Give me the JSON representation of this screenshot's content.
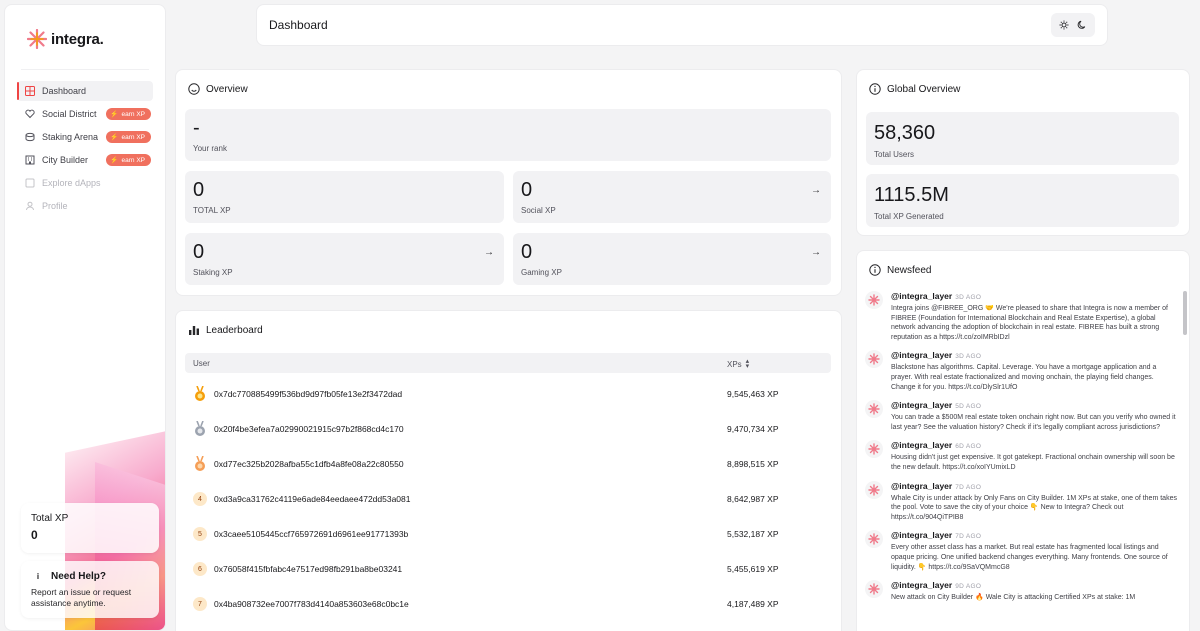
{
  "app": {
    "name": "integra."
  },
  "sidebar": {
    "items": [
      {
        "label": "Dashboard",
        "icon": "grid-icon",
        "active": true
      },
      {
        "label": "Social District",
        "icon": "heart-icon",
        "badge": "earn XP"
      },
      {
        "label": "Staking Arena",
        "icon": "database-icon",
        "badge": "earn XP"
      },
      {
        "label": "City Builder",
        "icon": "building-icon",
        "badge": "earn XP"
      },
      {
        "label": "Explore dApps",
        "icon": "apps-icon",
        "disabled": true
      },
      {
        "label": "Profile",
        "icon": "user-icon",
        "disabled": true
      }
    ],
    "total_xp": {
      "label": "Total XP",
      "value": "0"
    },
    "help": {
      "title": "Need Help?",
      "text": "Report an issue or request assistance anytime."
    }
  },
  "header": {
    "title": "Dashboard"
  },
  "overview": {
    "title": "Overview",
    "rank": {
      "value": "-",
      "label": "Your rank"
    },
    "stats": [
      {
        "value": "0",
        "label": "TOTAL XP"
      },
      {
        "value": "0",
        "label": "Social XP"
      },
      {
        "value": "0",
        "label": "Staking XP"
      },
      {
        "value": "0",
        "label": "Gaming XP"
      }
    ]
  },
  "leaderboard": {
    "title": "Leaderboard",
    "columns": [
      "User",
      "XPs"
    ],
    "rows": [
      {
        "rank": "1",
        "address": "0x7dc770885499f536bd9d97fb05fe13e2f3472dad",
        "xp": "9,545,463 XP"
      },
      {
        "rank": "2",
        "address": "0x20f4be3efea7a02990021915c97b2f868cd4c170",
        "xp": "9,470,734 XP"
      },
      {
        "rank": "3",
        "address": "0xd77ec325b2028afba55c1dfb4a8fe08a22c80550",
        "xp": "8,898,515 XP"
      },
      {
        "rank": "4",
        "address": "0xd3a9ca31762c4119e6ade84eedaee472dd53a081",
        "xp": "8,642,987 XP"
      },
      {
        "rank": "5",
        "address": "0x3caee5105445ccf765972691d6961ee91771393b",
        "xp": "5,532,187 XP"
      },
      {
        "rank": "6",
        "address": "0x76058f415fbfabc4e7517ed98fb291ba8be03241",
        "xp": "5,455,619 XP"
      },
      {
        "rank": "7",
        "address": "0x4ba908732ee7007f783d4140a853603e68c0bc1e",
        "xp": "4,187,489 XP"
      }
    ]
  },
  "global_overview": {
    "title": "Global Overview",
    "stats": [
      {
        "value": "58,360",
        "label": "Total Users"
      },
      {
        "value": "1115.5M",
        "label": "Total XP Generated"
      }
    ]
  },
  "newsfeed": {
    "title": "Newsfeed",
    "items": [
      {
        "user": "@integra_layer",
        "time": "3D AGO",
        "text": "Integra joins @FIBREE_ORG 🤝 We're pleased to share that Integra is now a member of FIBREE (Foundation for International Blockchain and Real Estate Expertise), a global network advancing the adoption of blockchain in real estate. FIBREE has built a strong reputation as a https://t.co/zoIMRbIDzl"
      },
      {
        "user": "@integra_layer",
        "time": "3D AGO",
        "text": "Blackstone has algorithms. Capital. Leverage. You have a mortgage application and a prayer. With real estate fractionalized and moving onchain, the playing field changes. Change it for you. https://t.co/DlySlr1UfO"
      },
      {
        "user": "@integra_layer",
        "time": "5D AGO",
        "text": "You can trade a $500M real estate token onchain right now. But can you verify who owned it last year? See the valuation history? Check if it's legally compliant across jurisdictions?"
      },
      {
        "user": "@integra_layer",
        "time": "6D AGO",
        "text": "Housing didn't just get expensive. It got gatekept. Fractional onchain ownership will soon be the new default. https://t.co/xoIYUmixLD"
      },
      {
        "user": "@integra_layer",
        "time": "7D AGO",
        "text": "Whale City is under attack by Only Fans on City Builder. 1M XPs at stake, one of them takes the pool. Vote to save the city of your choice 👇 New to Integra? Check out https://t.co/904QiTPIB8"
      },
      {
        "user": "@integra_layer",
        "time": "7D AGO",
        "text": "Every other asset class has a market. But real estate has fragmented local listings and opaque pricing. One unified backend changes everything. Many frontends. One source of liquidity. 👇 https://t.co/9SaVQMmcG8"
      },
      {
        "user": "@integra_layer",
        "time": "9D AGO",
        "text": "New attack on City Builder 🔥 Wale City is attacking Certified XPs at stake: 1M"
      }
    ]
  },
  "colors": {
    "accent": "#ef4444",
    "badge": "#f0705e",
    "gold": "#f59e0b",
    "silver": "#9ca3af",
    "bronze": "#f59e56"
  }
}
